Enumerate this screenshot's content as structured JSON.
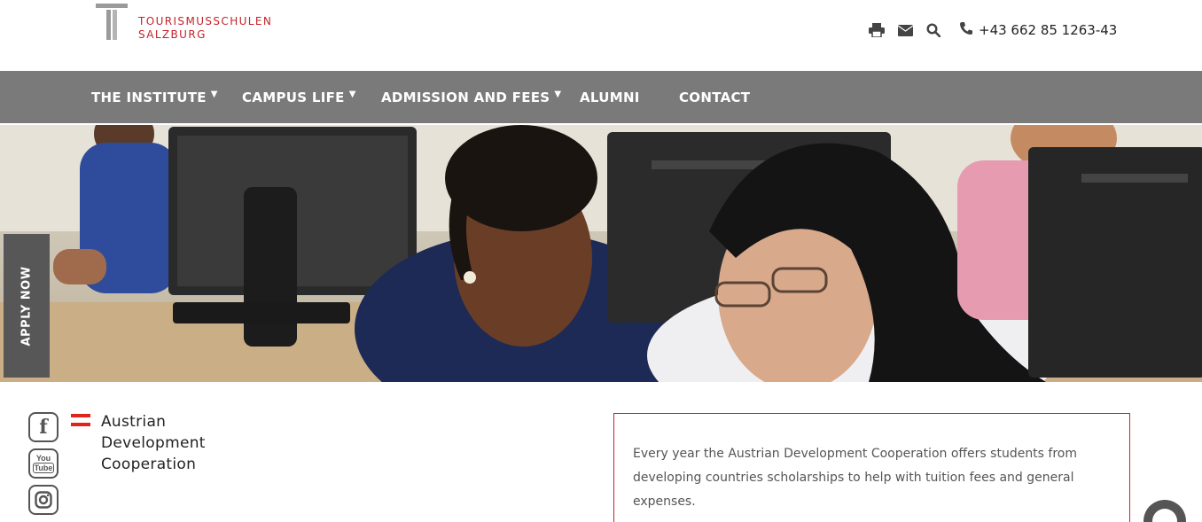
{
  "brand": {
    "line1": "TOURISMUSSCHULEN",
    "line2": "SALZBURG",
    "color": "#c4232b"
  },
  "header_tools": {
    "icons": [
      "print-icon",
      "email-icon",
      "search-icon",
      "phone-icon"
    ],
    "phone": "+43 662 85 1263-43"
  },
  "nav": {
    "items": [
      {
        "label": "THE INSTITUTE",
        "dropdown": true
      },
      {
        "label": "CAMPUS LIFE",
        "dropdown": true
      },
      {
        "label": "ADMISSION AND FEES",
        "dropdown": true
      },
      {
        "label": "ALUMNI",
        "dropdown": false
      },
      {
        "label": "CONTACT",
        "dropdown": false
      }
    ],
    "caret": "▼",
    "background": "#7a7a7a"
  },
  "apply_now": "APPLY NOW",
  "social": {
    "facebook": "f",
    "youtube_top": "You",
    "youtube_bottom": "Tube",
    "instagram": "instagram-icon"
  },
  "sponsor": {
    "line1": "Austrian",
    "line2": "Development",
    "line3": "Cooperation"
  },
  "info_box": {
    "text": "Every year the Austrian Development Cooperation offers students from developing countries scholarships to help with tuition fees and general expenses."
  }
}
